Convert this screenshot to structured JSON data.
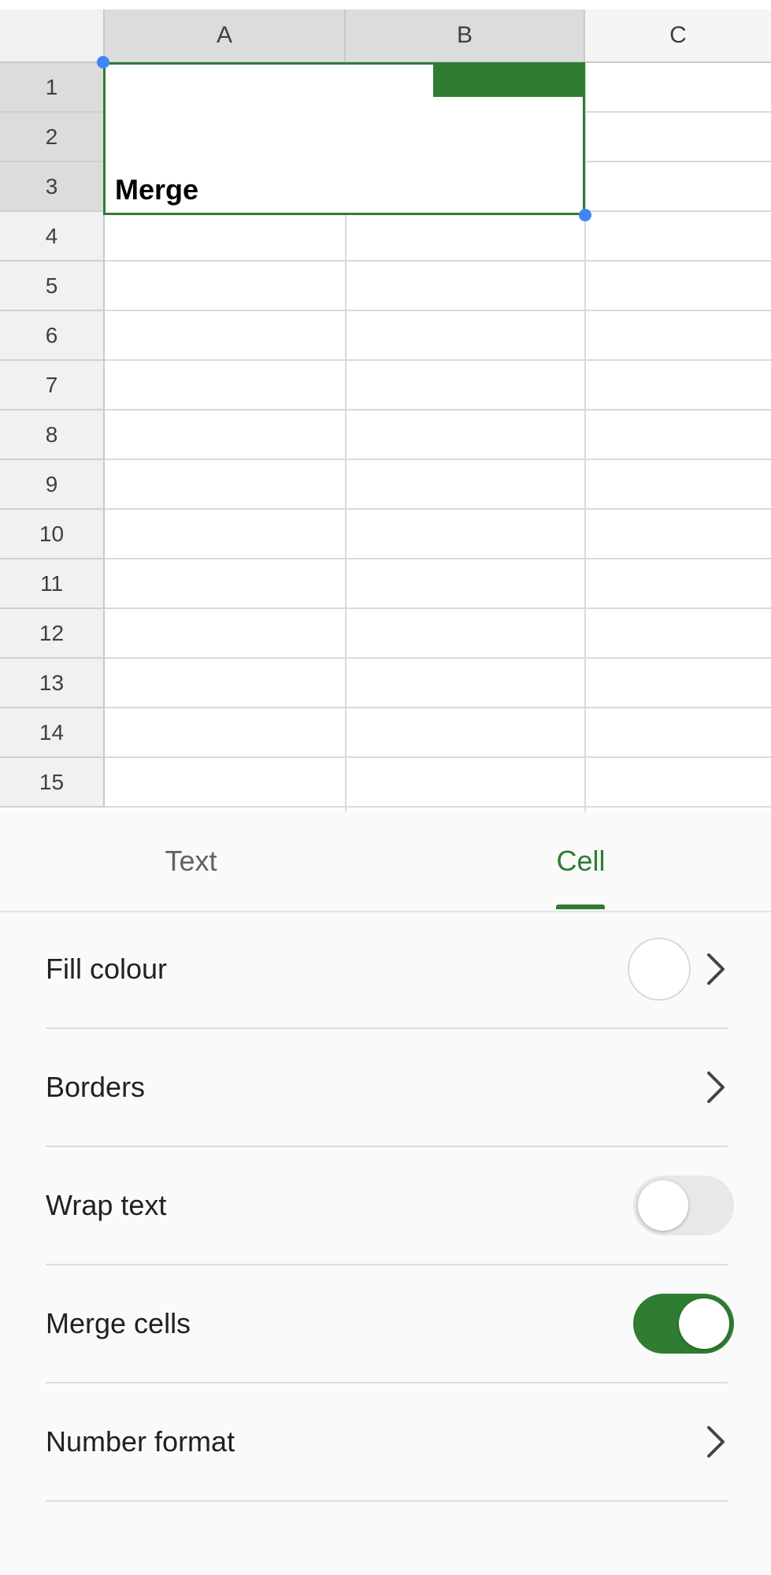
{
  "sheet": {
    "columns": [
      "A",
      "B",
      "C"
    ],
    "rows": [
      "1",
      "2",
      "3",
      "4",
      "5",
      "6",
      "7",
      "8",
      "9",
      "10",
      "11",
      "12",
      "13",
      "14",
      "15"
    ],
    "merged_cell_text": "Merge"
  },
  "tabs": [
    {
      "label": "Text",
      "active": false
    },
    {
      "label": "Cell",
      "active": true
    }
  ],
  "settings": {
    "fill_colour": {
      "label": "Fill colour",
      "color": "#ffffff"
    },
    "borders": {
      "label": "Borders"
    },
    "wrap_text": {
      "label": "Wrap text",
      "on": false
    },
    "merge_cells": {
      "label": "Merge cells",
      "on": true
    },
    "number_format": {
      "label": "Number format"
    }
  },
  "colors": {
    "accent": "#2e7d32",
    "toggle_off": "#e8e8e8",
    "selection_handle": "#4285f4"
  },
  "icons": [
    "chevron-right-icon"
  ]
}
